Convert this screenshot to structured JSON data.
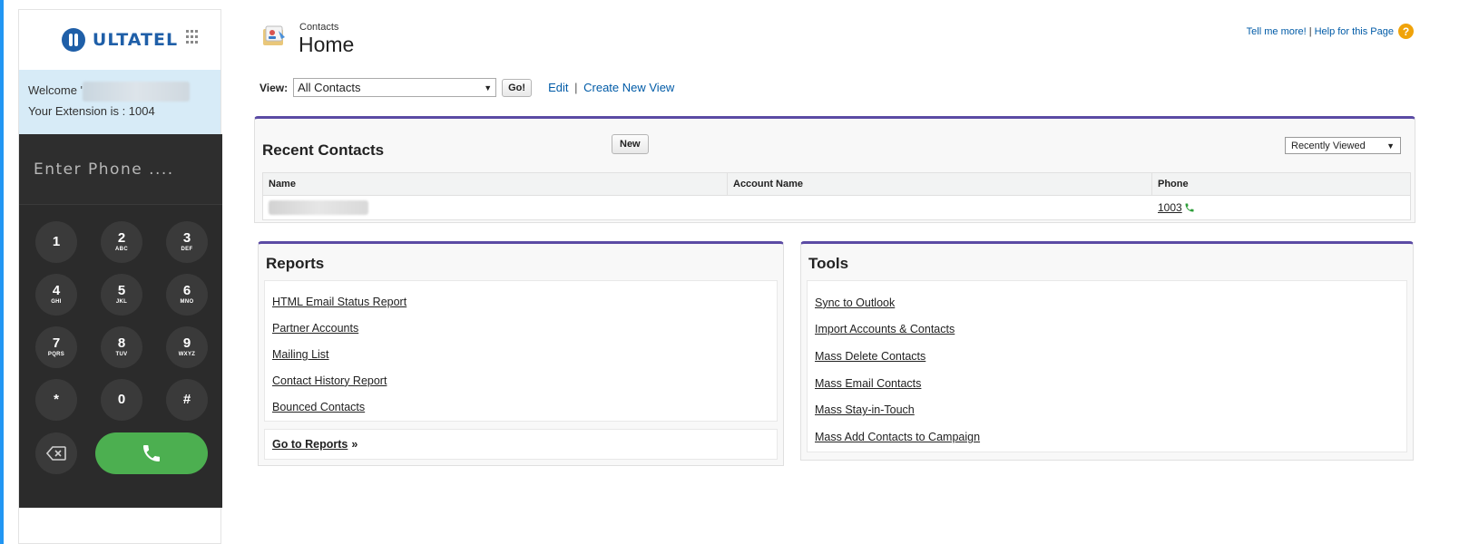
{
  "dialer": {
    "logo_text": "ULTATEL",
    "welcome_prefix": "Welcome '",
    "extension_text": "Your Extension is : 1004",
    "phone_placeholder": "Enter Phone ....",
    "keys": [
      {
        "digit": "1",
        "letters": ""
      },
      {
        "digit": "2",
        "letters": "ABC"
      },
      {
        "digit": "3",
        "letters": "DEF"
      },
      {
        "digit": "4",
        "letters": "GHI"
      },
      {
        "digit": "5",
        "letters": "JKL"
      },
      {
        "digit": "6",
        "letters": "MNO"
      },
      {
        "digit": "7",
        "letters": "PQRS"
      },
      {
        "digit": "8",
        "letters": "TUV"
      },
      {
        "digit": "9",
        "letters": "WXYZ"
      },
      {
        "digit": "*",
        "letters": ""
      },
      {
        "digit": "0",
        "letters": ""
      },
      {
        "digit": "#",
        "letters": ""
      }
    ],
    "call_color": "#4caf50"
  },
  "header": {
    "subtitle": "Contacts",
    "title": "Home",
    "tell_me_more": "Tell me more!",
    "separator": "|",
    "help_link": "Help for this Page",
    "help_icon": "?"
  },
  "view": {
    "label": "View:",
    "selected": "All Contacts",
    "go_button": "Go!",
    "edit_link": "Edit",
    "separator": "|",
    "create_link": "Create New View"
  },
  "recent_contacts": {
    "title": "Recent Contacts",
    "new_button": "New",
    "sort_selected": "Recently Viewed",
    "columns": [
      "Name",
      "Account Name",
      "Phone"
    ],
    "rows": [
      {
        "name": "",
        "account_name": "",
        "phone": "1003"
      }
    ]
  },
  "reports": {
    "title": "Reports",
    "links": [
      "HTML Email Status Report",
      "Partner Accounts",
      "Mailing List",
      "Contact History Report",
      "Bounced Contacts"
    ],
    "goto_label": "Go to Reports",
    "goto_suffix": "»"
  },
  "tools": {
    "title": "Tools",
    "links": [
      "Sync to Outlook",
      "Import Accounts & Contacts",
      "Mass Delete Contacts",
      "Mass Email Contacts",
      "Mass Stay-in-Touch",
      "Mass Add Contacts to Campaign"
    ]
  },
  "colors": {
    "accent_panel_border": "#5b4ba4",
    "link_blue": "#015ba7",
    "sidebar_edge": "#2196f3",
    "help_orange": "#f0a30a"
  }
}
